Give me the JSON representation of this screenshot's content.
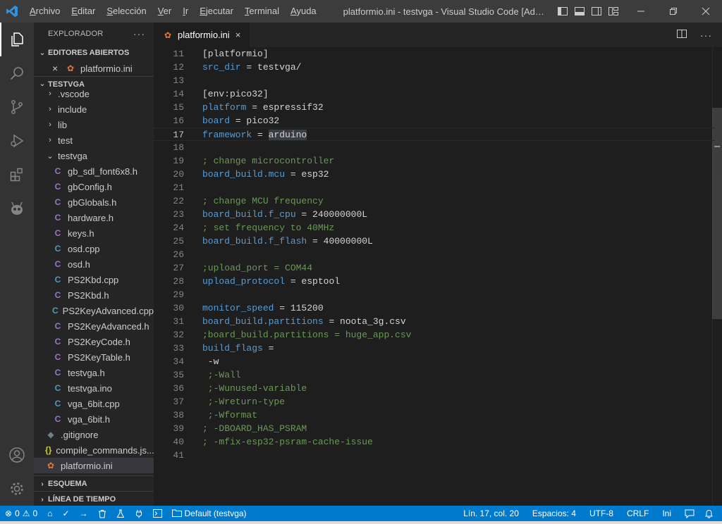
{
  "titlebar": {
    "menu": [
      "Archivo",
      "Editar",
      "Selección",
      "Ver",
      "Ir",
      "Ejecutar",
      "Terminal",
      "Ayuda"
    ],
    "window_title": "platformio.ini - testvga - Visual Studio Code [Administra..."
  },
  "activity": {
    "items": [
      "explorer-icon",
      "search-icon",
      "source-control-icon",
      "run-debug-icon",
      "extensions-icon",
      "platformio-icon"
    ],
    "bottom": [
      "account-icon",
      "settings-gear-icon"
    ]
  },
  "sidebar": {
    "title": "EXPLORADOR",
    "more": "···",
    "open_editors": {
      "label": "EDITORES ABIERTOS",
      "items": [
        {
          "close": "×",
          "icon": "ini",
          "name": "platformio.ini"
        }
      ]
    },
    "project": {
      "label": "TESTVGA",
      "tree": [
        {
          "type": "folder",
          "chev": "›",
          "name": ".vscode",
          "indent": 0
        },
        {
          "type": "folder",
          "chev": "›",
          "name": "include",
          "indent": 0
        },
        {
          "type": "folder",
          "chev": "›",
          "name": "lib",
          "indent": 0
        },
        {
          "type": "folder",
          "chev": "›",
          "name": "test",
          "indent": 0
        },
        {
          "type": "folder",
          "chev": "⌄",
          "name": "testvga",
          "indent": 0
        },
        {
          "type": "file",
          "icon": "C",
          "kind": "c",
          "name": "gb_sdl_font6x8.h",
          "indent": 1
        },
        {
          "type": "file",
          "icon": "C",
          "kind": "c",
          "name": "gbConfig.h",
          "indent": 1
        },
        {
          "type": "file",
          "icon": "C",
          "kind": "c",
          "name": "gbGlobals.h",
          "indent": 1
        },
        {
          "type": "file",
          "icon": "C",
          "kind": "c",
          "name": "hardware.h",
          "indent": 1
        },
        {
          "type": "file",
          "icon": "C",
          "kind": "c",
          "name": "keys.h",
          "indent": 1
        },
        {
          "type": "file",
          "icon": "C",
          "kind": "cpp",
          "name": "osd.cpp",
          "indent": 1
        },
        {
          "type": "file",
          "icon": "C",
          "kind": "c",
          "name": "osd.h",
          "indent": 1
        },
        {
          "type": "file",
          "icon": "C",
          "kind": "cpp",
          "name": "PS2Kbd.cpp",
          "indent": 1
        },
        {
          "type": "file",
          "icon": "C",
          "kind": "c",
          "name": "PS2Kbd.h",
          "indent": 1
        },
        {
          "type": "file",
          "icon": "C",
          "kind": "cpp",
          "name": "PS2KeyAdvanced.cpp",
          "indent": 1
        },
        {
          "type": "file",
          "icon": "C",
          "kind": "c",
          "name": "PS2KeyAdvanced.h",
          "indent": 1
        },
        {
          "type": "file",
          "icon": "C",
          "kind": "c",
          "name": "PS2KeyCode.h",
          "indent": 1
        },
        {
          "type": "file",
          "icon": "C",
          "kind": "c",
          "name": "PS2KeyTable.h",
          "indent": 1
        },
        {
          "type": "file",
          "icon": "C",
          "kind": "c",
          "name": "testvga.h",
          "indent": 1
        },
        {
          "type": "file",
          "icon": "C",
          "kind": "cpp",
          "name": "testvga.ino",
          "indent": 1
        },
        {
          "type": "file",
          "icon": "C",
          "kind": "cpp",
          "name": "vga_6bit.cpp",
          "indent": 1
        },
        {
          "type": "file",
          "icon": "C",
          "kind": "c",
          "name": "vga_6bit.h",
          "indent": 1
        },
        {
          "type": "file",
          "icon": "◆",
          "kind": "git",
          "name": ".gitignore",
          "indent": 0
        },
        {
          "type": "file",
          "icon": "{}",
          "kind": "json",
          "name": "compile_commands.js...",
          "indent": 0
        },
        {
          "type": "file",
          "icon": "✿",
          "kind": "ini",
          "name": "platformio.ini",
          "indent": 0,
          "selected": true
        }
      ]
    },
    "outline": "ESQUEMA",
    "timeline": "LÍNEA DE TIEMPO"
  },
  "tabs": [
    {
      "name": "platformio.ini",
      "close": "×"
    }
  ],
  "editor": {
    "current_line": 17,
    "lines": [
      {
        "n": 11,
        "parts": [
          [
            "",
            "[platformio]"
          ]
        ]
      },
      {
        "n": 12,
        "parts": [
          [
            "key",
            "src_dir"
          ],
          [
            "",
            " = testvga/"
          ]
        ]
      },
      {
        "n": 13,
        "parts": []
      },
      {
        "n": 14,
        "parts": [
          [
            "",
            "[env:pico32]"
          ]
        ]
      },
      {
        "n": 15,
        "parts": [
          [
            "key",
            "platform"
          ],
          [
            "",
            " = espressif32"
          ]
        ]
      },
      {
        "n": 16,
        "parts": [
          [
            "key",
            "board"
          ],
          [
            "",
            " = pico32"
          ]
        ]
      },
      {
        "n": 17,
        "parts": [
          [
            "key",
            "framework"
          ],
          [
            "",
            " = "
          ],
          [
            "hl",
            "arduino"
          ]
        ]
      },
      {
        "n": 18,
        "parts": []
      },
      {
        "n": 19,
        "parts": [
          [
            "cmt",
            "; change microcontroller"
          ]
        ]
      },
      {
        "n": 20,
        "parts": [
          [
            "key",
            "board_build.mcu"
          ],
          [
            "",
            " = esp32"
          ]
        ]
      },
      {
        "n": 21,
        "parts": []
      },
      {
        "n": 22,
        "parts": [
          [
            "cmt",
            "; change MCU frequency"
          ]
        ]
      },
      {
        "n": 23,
        "parts": [
          [
            "key",
            "board_build.f_cpu"
          ],
          [
            "",
            " = 240000000L"
          ]
        ]
      },
      {
        "n": 24,
        "parts": [
          [
            "cmt",
            "; set frequency to 40MHz"
          ]
        ]
      },
      {
        "n": 25,
        "parts": [
          [
            "key",
            "board_build.f_flash"
          ],
          [
            "",
            " = 40000000L"
          ]
        ]
      },
      {
        "n": 26,
        "parts": []
      },
      {
        "n": 27,
        "parts": [
          [
            "cmt",
            ";upload_port = COM44"
          ]
        ]
      },
      {
        "n": 28,
        "parts": [
          [
            "key",
            "upload_protocol"
          ],
          [
            "",
            " = esptool"
          ]
        ]
      },
      {
        "n": 29,
        "parts": []
      },
      {
        "n": 30,
        "parts": [
          [
            "key",
            "monitor_speed"
          ],
          [
            "",
            " = 115200"
          ]
        ]
      },
      {
        "n": 31,
        "parts": [
          [
            "key",
            "board_build.partitions"
          ],
          [
            "",
            " = noota_3g.csv"
          ]
        ]
      },
      {
        "n": 32,
        "parts": [
          [
            "cmt",
            ";board_build.partitions = huge_app.csv"
          ]
        ]
      },
      {
        "n": 33,
        "parts": [
          [
            "key",
            "build_flags"
          ],
          [
            "",
            " ="
          ]
        ]
      },
      {
        "n": 34,
        "parts": [
          [
            "",
            " -w"
          ]
        ]
      },
      {
        "n": 35,
        "parts": [
          [
            "cmt",
            " ;-Wall"
          ]
        ]
      },
      {
        "n": 36,
        "parts": [
          [
            "cmt",
            " ;-Wunused-variable"
          ]
        ]
      },
      {
        "n": 37,
        "parts": [
          [
            "cmt",
            " ;-Wreturn-type"
          ]
        ]
      },
      {
        "n": 38,
        "parts": [
          [
            "cmt",
            " ;-Wformat"
          ]
        ]
      },
      {
        "n": 39,
        "parts": [
          [
            "cmt",
            "; -DBOARD_HAS_PSRAM"
          ]
        ]
      },
      {
        "n": 40,
        "parts": [
          [
            "cmt",
            "; -mfix-esp32-psram-cache-issue"
          ]
        ]
      },
      {
        "n": 41,
        "parts": []
      }
    ]
  },
  "statusbar": {
    "errors": "0",
    "warnings": "0",
    "env": "Default (testvga)",
    "position": "Lín. 17, col. 20",
    "spaces": "Espacios: 4",
    "encoding": "UTF-8",
    "eol": "CRLF",
    "language": "Ini"
  },
  "colors": {
    "accent": "#007acc",
    "activity_bg": "#333333",
    "sidebar_bg": "#252526",
    "editor_bg": "#1e1e1e",
    "keyword": "#569cd6",
    "comment": "#6a9955"
  }
}
